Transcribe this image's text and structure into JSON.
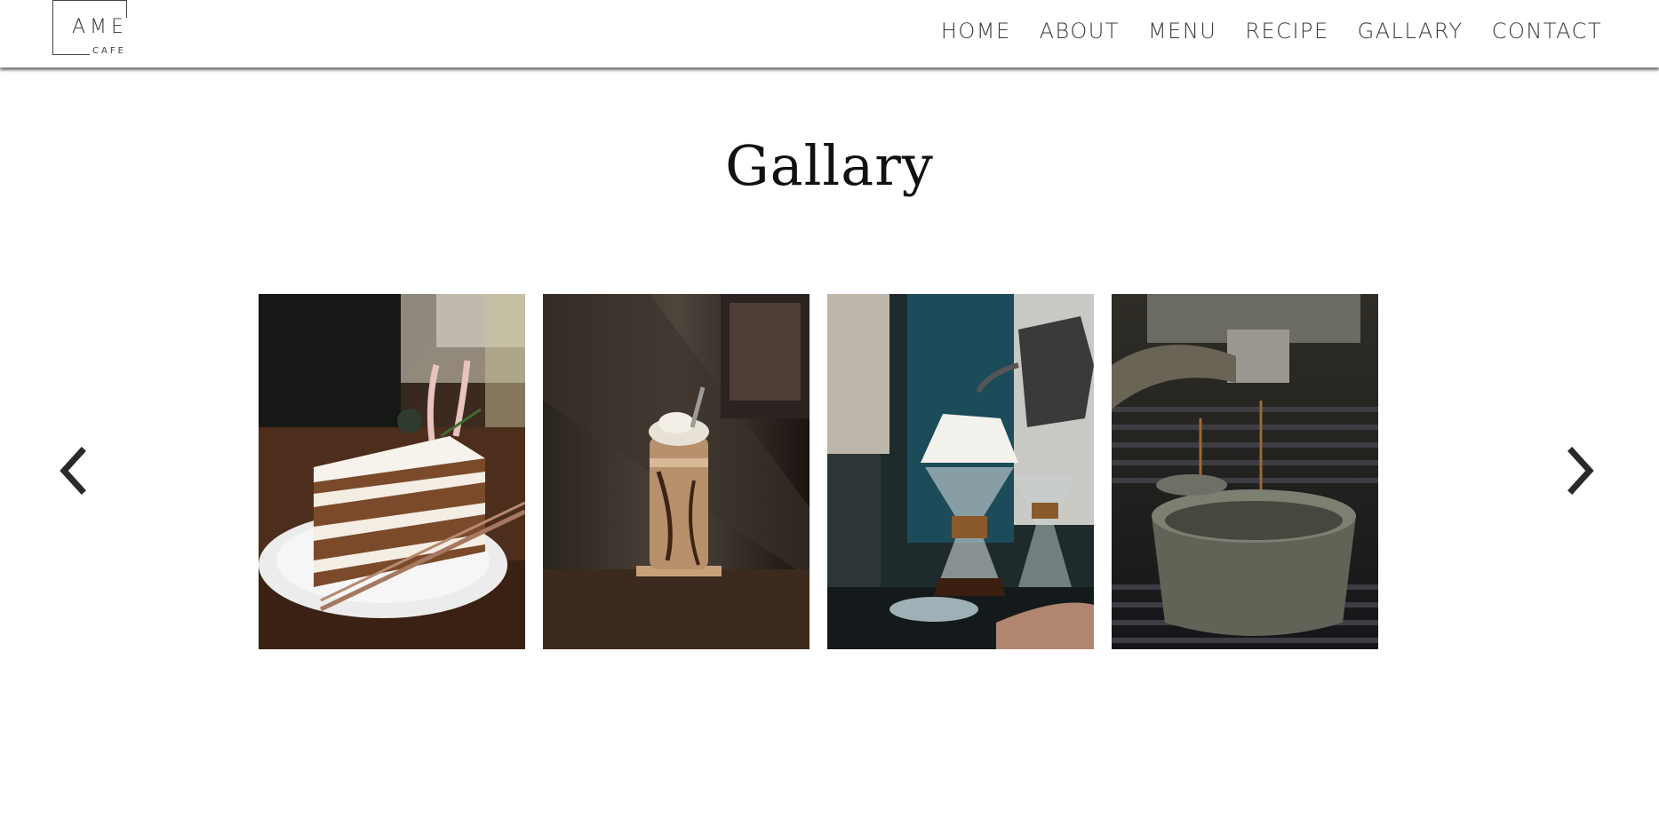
{
  "logo": {
    "main": "AME",
    "sub": "CAFE"
  },
  "nav": {
    "items": [
      "HOME",
      "ABOUT",
      "MENU",
      "RECIPE",
      "GALLARY",
      "CONTACT"
    ]
  },
  "gallery": {
    "title": "Gallary",
    "photos": [
      {
        "icon": "carrot-cake-photo"
      },
      {
        "icon": "iced-mocha-jar-photo"
      },
      {
        "icon": "pour-over-coffee-photo"
      },
      {
        "icon": "espresso-machine-cup-photo"
      }
    ],
    "prev_icon": "chevron-left-icon",
    "next_icon": "chevron-right-icon"
  },
  "colors": {
    "text": "#3a3a3a",
    "title": "#111111",
    "background": "#ffffff",
    "arrow": "#2a2a2a"
  }
}
